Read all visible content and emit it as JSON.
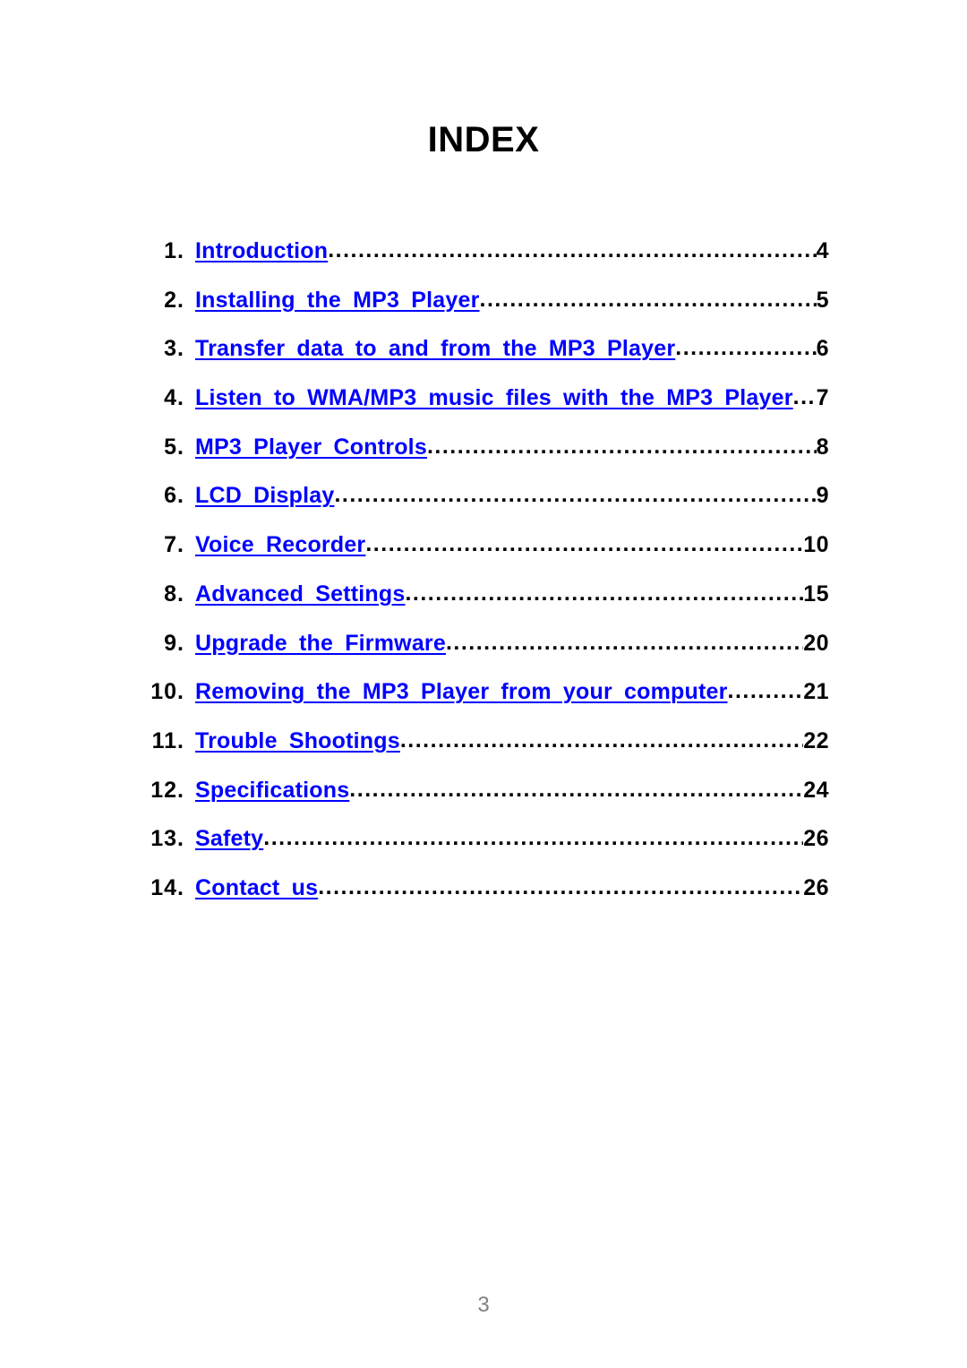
{
  "document": {
    "title": "INDEX",
    "page_number": "3",
    "colors": {
      "entry_link": "#0000FF",
      "entry_number": "#000000",
      "leader_dots": "#000000",
      "folio": "#808080",
      "background": "#FFFFFF"
    }
  },
  "toc": {
    "entries": [
      {
        "number": "1.",
        "title": "Introduction ",
        "page": "4"
      },
      {
        "number": "2.",
        "title": "Installing the MP3 Player",
        "page": "5"
      },
      {
        "number": "3.",
        "title": "Transfer data to and from the MP3 Player",
        "page": "6"
      },
      {
        "number": "4.",
        "title": "Listen to WMA/MP3 music files with the MP3 Player",
        "page": "7"
      },
      {
        "number": "5.",
        "title": "MP3 Player Controls",
        "page": "8"
      },
      {
        "number": "6.",
        "title": "LCD Display ",
        "page": "9"
      },
      {
        "number": "7.",
        "title": "Voice Recorder",
        "page": "10"
      },
      {
        "number": "8.",
        "title": "Advanced Settings",
        "page": "15"
      },
      {
        "number": "9.",
        "title": "Upgrade the Firmware",
        "page": "20"
      },
      {
        "number": "10.",
        "title": "Removing the MP3 Player from your computer",
        "page": "21"
      },
      {
        "number": "11.",
        "title": "Trouble Shootings ",
        "page": "22"
      },
      {
        "number": "12.",
        "title": "Specifications ",
        "page": "24"
      },
      {
        "number": "13.",
        "title": "Safety",
        "page": "26"
      },
      {
        "number": "14.",
        "title": "Contact us",
        "page": "26"
      }
    ]
  }
}
